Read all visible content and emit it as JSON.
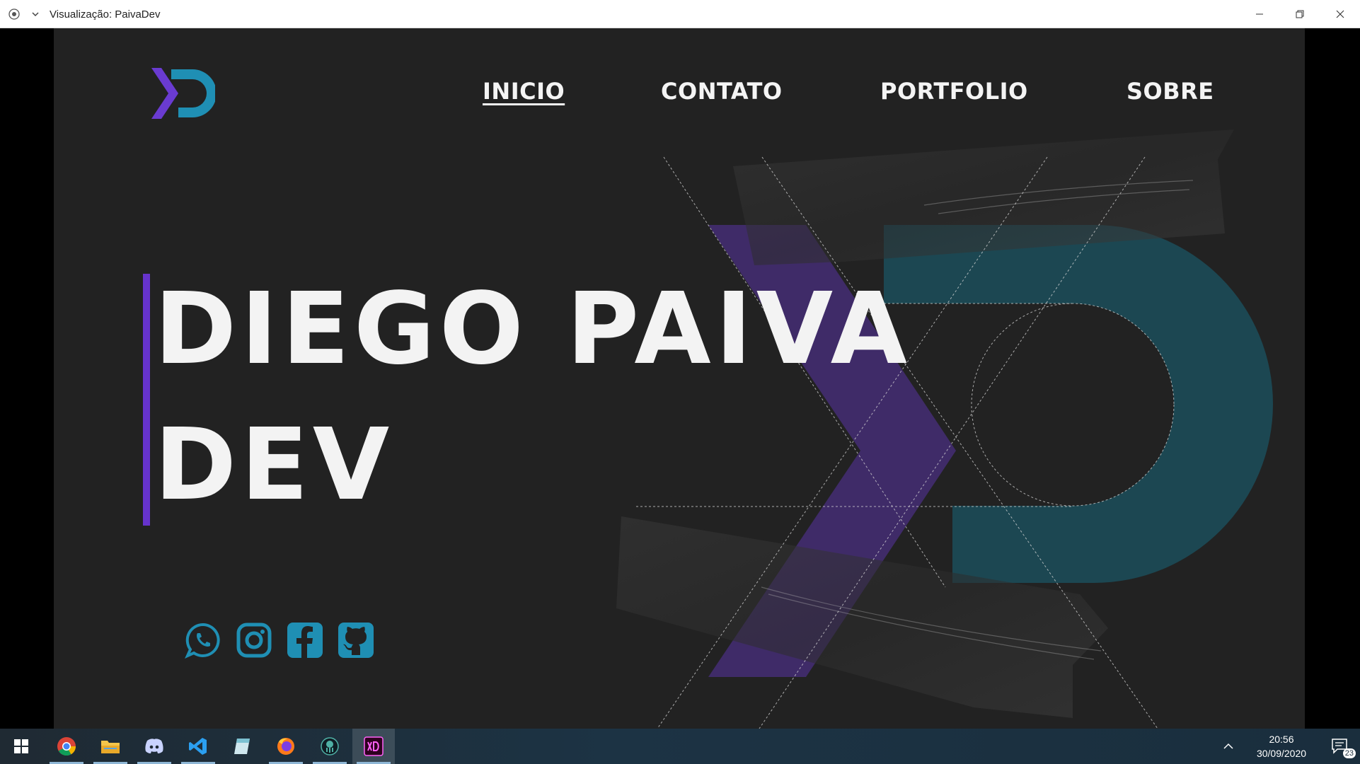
{
  "window": {
    "title": "Visualização: PaivaDev",
    "controls": [
      "minimize-icon",
      "restore-icon",
      "close-icon"
    ]
  },
  "nav": {
    "items": [
      {
        "label": "INICIO",
        "active": true
      },
      {
        "label": "CONTATO",
        "active": false
      },
      {
        "label": "PORTFOLIO",
        "active": false
      },
      {
        "label": "SOBRE",
        "active": false
      }
    ]
  },
  "hero": {
    "line1": "DIEGO PAIVA",
    "line2": "DEV"
  },
  "socials": [
    "whatsapp-icon",
    "instagram-icon",
    "facebook-icon",
    "github-icon"
  ],
  "colors": {
    "background": "#222222",
    "text": "#f3f3f3",
    "purple": "#6633cc",
    "teal": "#1f8fb4",
    "social": "#1f8fb4"
  },
  "taskbar": {
    "apps": [
      "windows-start-icon",
      "chrome-icon",
      "file-explorer-icon",
      "discord-icon",
      "vscode-icon",
      "notes-icon",
      "firefox-icon",
      "gitkraken-icon",
      "adobe-xd-icon"
    ],
    "active_app": "adobe-xd-icon",
    "time": "20:56",
    "date": "30/09/2020",
    "notification_count": "23"
  }
}
